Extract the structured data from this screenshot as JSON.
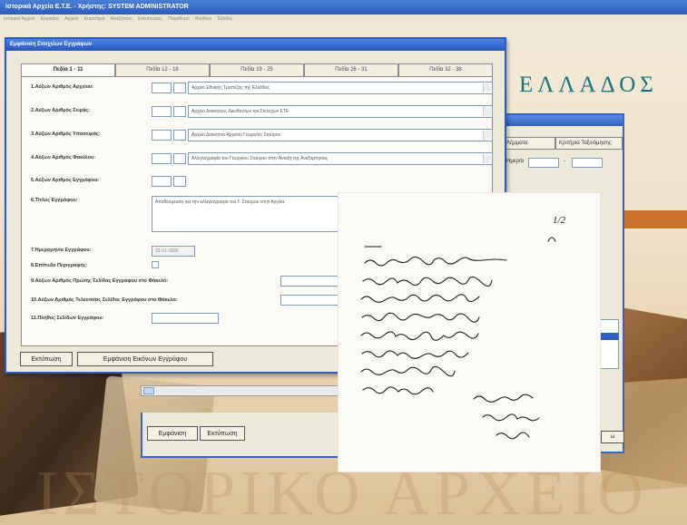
{
  "app": {
    "title": "Ιστορικά Αρχεία Ε.Τ.Ε. - Χρήστης: SYSTEM ADMINISTRATOR",
    "menu": [
      "Ιστορικό Αρχείο",
      "Εργασίες",
      "Αρχεία",
      "Ευρετήρια",
      "Αναζήτηση",
      "Εκτυπώσεις",
      "Παράθυρα",
      "Βοήθεια",
      "Έξοδος"
    ]
  },
  "background": {
    "title": "ΕΛΛΑΔΟΣ",
    "bottom_text": "ΙΣΤΟΡΙΚΟ ΑΡΧΕΙΟ"
  },
  "back_window": {
    "tabs": [
      "Λήμματα",
      "Κριτήρια Ταξινόμησης"
    ],
    "date_label": "Ημερ/α",
    "range_sep": "-",
    "close_button": "ω",
    "search_button": "Εμφάνιση",
    "print_button": "Εκτύπωση"
  },
  "dialog": {
    "title": "Εμφάνιση Στοιχείων Εγγράφων",
    "tabs": [
      "Πεδία 1 - 11",
      "Πεδία 12 - 18",
      "Πεδία 19 - 25",
      "Πεδία 26 - 31",
      "Πεδία 32 - 38"
    ],
    "active_tab": 0,
    "fields": {
      "archive_no": {
        "label": "1.Αύξων Αριθμός Αρχείου:",
        "desc": "Αρχείο Εθνικής Τραπέζης της Ελλάδος"
      },
      "series_no": {
        "label": "2.Αύξων Αριθμός Σειράς:",
        "desc": "Αρχείο Διοικητών, Διευθυντών και Στελεχών ΕΤΕ"
      },
      "subseries_no": {
        "label": "3.Αύξων Αριθμός Υποσειράς:",
        "desc": "Αρχείο Διοικητού Αρχείου Γεωργίου Σταύρου"
      },
      "folder_no": {
        "label": "4.Αύξων Αριθμός Φακέλου:",
        "desc": "Αλληλογραφία του Γεωργίου Σταύρου στην Άνοιξη της Ανεξαρτησίας"
      },
      "document_no": {
        "label": "5.Αύξων Αριθμός Εγγράφου:"
      },
      "document_title": {
        "label": "6.Τίτλος Εγγράφου:",
        "value": "Αποδέσμευση για την αλληλογραφία του Γ. Σταύρου στην Αγγλία"
      },
      "document_date": {
        "label": "7.Ημερομηνία Εγγράφου:",
        "value": "22-01-1826"
      },
      "detail_level": {
        "label": "8.Επίπεδο Περιγραφής:"
      },
      "first_page": {
        "label": "9.Αύξων Αριθμός Πρώτης Σελίδας Εγγράφου στο Φάκελο:"
      },
      "last_page": {
        "label": "10.Αύξων Αριθμός Τελευταίας Σελίδας Εγγράφου στο Φάκελο:"
      },
      "page_count": {
        "label": "11.Πλήθος Σελίδων Εγγράφου:"
      }
    },
    "buttons": {
      "print": "Εκτύπωση",
      "show_image": "Εμφάνιση Εικόνων Εγγράφου"
    }
  },
  "document_image": {
    "page_marker": "1/2",
    "colors": {
      "paper": "#fbfaf6",
      "ink": "#1d1d1d"
    }
  },
  "colors": {
    "title_blue": "#2a5bc3",
    "teal_text": "#15757e",
    "panel": "#ece9d8",
    "band_orange": "#c9722a"
  }
}
